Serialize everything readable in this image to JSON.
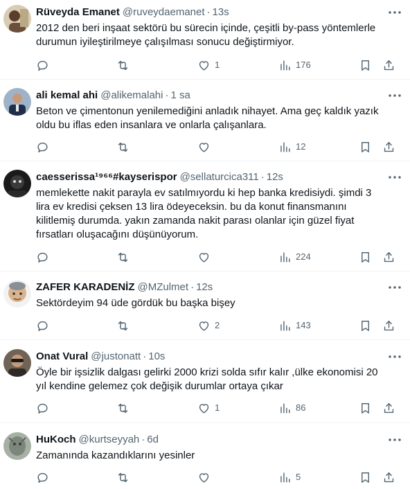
{
  "tweets": [
    {
      "name": "Rüveyda Emanet",
      "handle": "@ruveydaemanet",
      "dot": "·",
      "time": "13s",
      "text": "2012 den beri inşaat sektörü bu sürecin içinde, çeşitli by-pass yöntemlerle\ndurumun iyileştirilmeye çalışılması sonucu değiştirmiyor.",
      "likes": "1",
      "views": "176",
      "avatar_color": "#c8b89a"
    },
    {
      "name": "ali kemal ahi",
      "handle": "@alikemalahi",
      "dot": "·",
      "time": "1 sa",
      "text": "Beton ve çimentonun yenilemediğini anladık nihayet. Ama geç kaldık yazık\noldu bu iflas eden insanlara ve onlarla çalışanlara.",
      "likes": "",
      "views": "12",
      "avatar_color": "#3b5675"
    },
    {
      "name": "caesserissa¹⁹⁶⁶#kayserispor",
      "handle": "@sellaturcica311",
      "dot": "·",
      "time": "12s",
      "text": "memlekette nakit parayla ev satılmıyordu ki hep banka kredisiydi. şimdi 3\nlira ev kredisi çeksen 13 lira ödeyeceksin. bu da konut finansmanını\nkilitlemiş durumda. yakın zamanda nakit parası olanlar için güzel fiyat\nfırsatları oluşacağını düşünüyorum.",
      "likes": "",
      "views": "224",
      "avatar_color": "#2b2b2b"
    },
    {
      "name": "ZAFER KARADENİZ",
      "handle": "@MZulmet",
      "dot": "·",
      "time": "12s",
      "text": "Sektördeyim 94 üde gördük bu başka bişey",
      "likes": "2",
      "views": "143",
      "avatar_color": "#e6e6e6"
    },
    {
      "name": "Onat Vural",
      "handle": "@justonatt",
      "dot": "·",
      "time": "10s",
      "text": "Öyle bir işsizlik dalgası gelirki 2000 krizi solda sıfır kalır ,ülke ekonomisi 20\nyıl kendine gelemez çok değişik durumlar ortaya çıkar",
      "likes": "1",
      "views": "86",
      "avatar_color": "#8a7a6a"
    },
    {
      "name": "HuKoch",
      "handle": "@kurtseyyah",
      "dot": "·",
      "time": "6d",
      "text": "Zamanında kazandıklarını yesinler",
      "likes": "",
      "views": "5",
      "avatar_color": "#9aa49a"
    }
  ]
}
